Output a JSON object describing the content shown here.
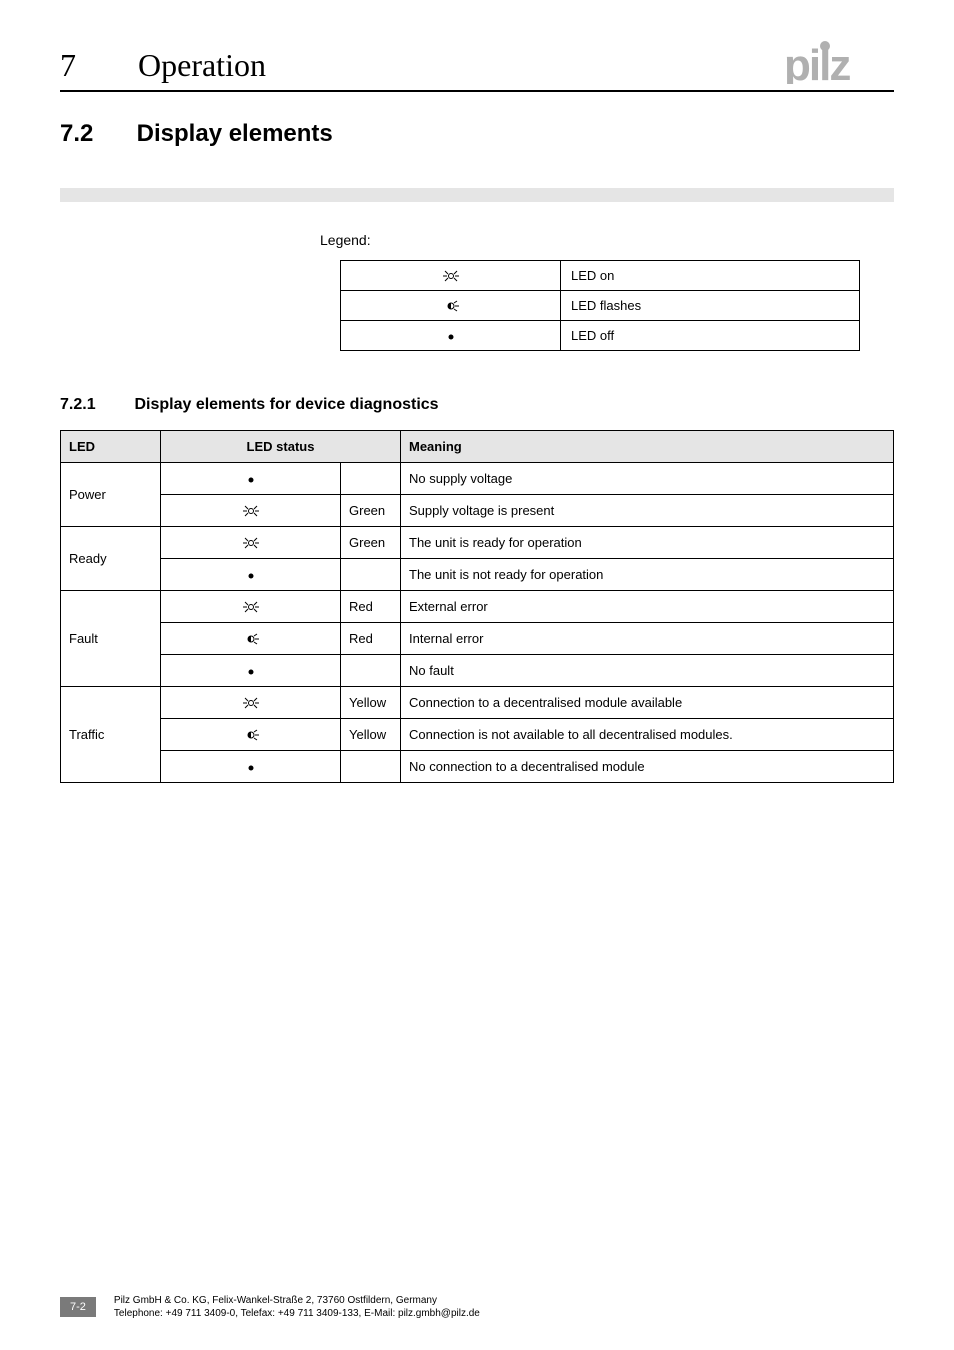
{
  "header": {
    "chapter_num": "7",
    "chapter_title": "Operation",
    "logo_text": "pilz"
  },
  "section": {
    "num": "7.2",
    "title": "Display elements"
  },
  "legend": {
    "label": "Legend:",
    "rows": [
      {
        "desc": "LED on"
      },
      {
        "desc": "LED flashes"
      },
      {
        "desc": "LED off"
      }
    ]
  },
  "subsection": {
    "num": "7.2.1",
    "title": "Display elements for device diagnostics"
  },
  "diag_table": {
    "headers": {
      "led": "LED",
      "status": "LED status",
      "meaning": "Meaning"
    },
    "groups": [
      {
        "led": "Power",
        "rows": [
          {
            "icon": "off",
            "color": "",
            "meaning": "No supply voltage"
          },
          {
            "icon": "on",
            "color": "Green",
            "meaning": "Supply voltage is present"
          }
        ]
      },
      {
        "led": "Ready",
        "rows": [
          {
            "icon": "on",
            "color": "Green",
            "meaning": "The unit is ready for operation"
          },
          {
            "icon": "off",
            "color": "",
            "meaning": "The unit is not ready for operation"
          }
        ]
      },
      {
        "led": "Fault",
        "rows": [
          {
            "icon": "on",
            "color": "Red",
            "meaning": "External error"
          },
          {
            "icon": "flash",
            "color": "Red",
            "meaning": "Internal error"
          },
          {
            "icon": "off",
            "color": "",
            "meaning": "No fault"
          }
        ]
      },
      {
        "led": "Traffic",
        "rows": [
          {
            "icon": "on",
            "color": "Yellow",
            "meaning": "Connection to a decentralised module available"
          },
          {
            "icon": "flash",
            "color": "Yellow",
            "meaning": "Connection is not available to all decentralised modules."
          },
          {
            "icon": "off",
            "color": "",
            "meaning": "No connection to a decentralised module"
          }
        ]
      }
    ]
  },
  "footer": {
    "page": "7-2",
    "line1": "Pilz GmbH & Co. KG, Felix-Wankel-Straße 2, 73760 Ostfildern, Germany",
    "line2": "Telephone: +49 711 3409-0, Telefax: +49 711 3409-133, E-Mail: pilz.gmbh@pilz.de"
  }
}
